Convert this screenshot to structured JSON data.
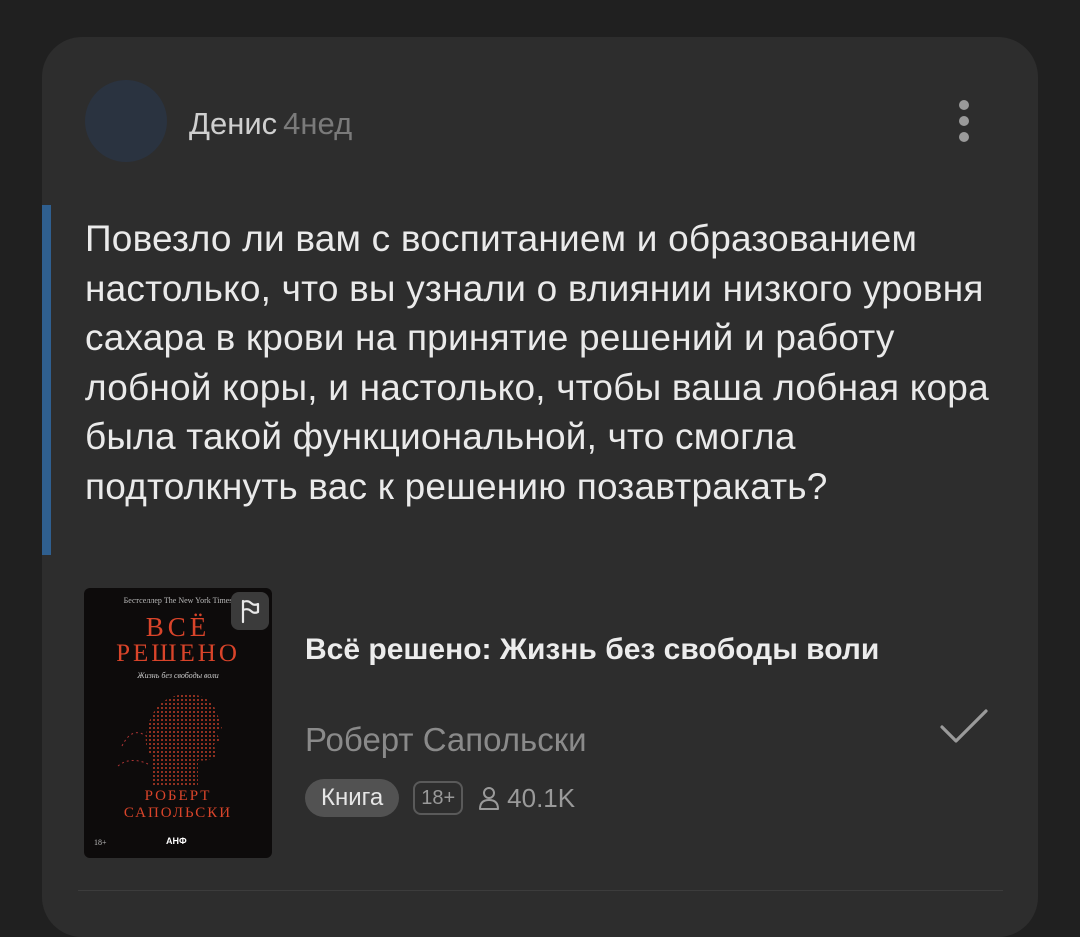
{
  "post": {
    "author_name": "Денис",
    "time_ago": "4нед",
    "quote": "Повезло ли вам с воспитанием и образованием настолько, что вы узнали о влиянии низкого уровня сахара в крови на принятие решений и работу лобной коры, и настолько, чтобы ваша лобная кора была такой функциональной, что смогла подтолкнуть вас к решению позавтракать?"
  },
  "book": {
    "title": "Всё решено: Жизнь без свободы воли",
    "author": "Роберт Сапольски",
    "type_label": "Книга",
    "age_rating": "18+",
    "readers_count": "40.1K",
    "cover": {
      "top_line": "Бестселлер The New York Times",
      "title_line1": "ВСЁ",
      "title_line2": "РЕШЕНО",
      "subtitle": "Жизнь без свободы воли",
      "author_line1": "РОБЕРТ",
      "author_line2": "САПОЛЬСКИ",
      "age": "18+",
      "publisher": "АНФ"
    }
  },
  "icons": {
    "menu": "more-vertical-icon",
    "flag": "flag-icon",
    "check": "check-icon",
    "readers": "user-icon"
  },
  "colors": {
    "background": "#202020",
    "card": "#2d2d2d",
    "quote_accent": "#2f5f8f",
    "cover_accent": "#d9442a"
  }
}
